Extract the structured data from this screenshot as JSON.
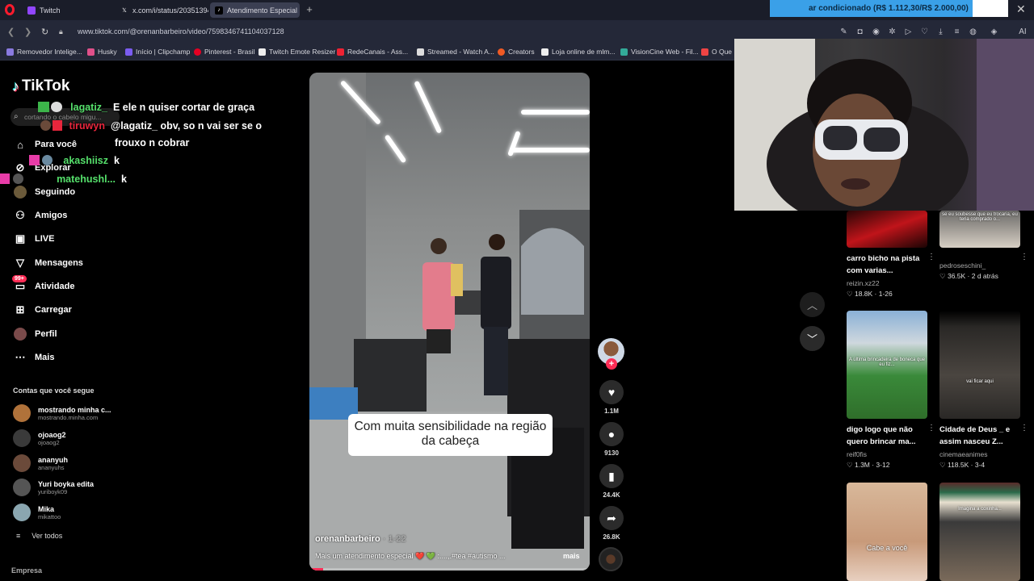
{
  "browser": {
    "tabs": [
      {
        "label": "Twitch",
        "icon": "twitch-icon"
      },
      {
        "label": "x.com/i/status/203513940",
        "icon": "x-icon"
      },
      {
        "label": "Atendimento Especial",
        "icon": "tiktok-icon"
      }
    ],
    "url": "www.tiktok.com/@orenanbarbeiro/video/7598346741104037128",
    "bookmarks": [
      "Removedor Intelige...",
      "Husky",
      "Início | Clipchamp",
      "Pinterest - Brasil",
      "Twitch Emote Resizer",
      "RedeCanais - Ass...",
      "Streamed - Watch A...",
      "Creators",
      "Loja online de mlm...",
      "VisionCine Web - Fil...",
      "O Que"
    ],
    "ai_label": "AI"
  },
  "overlay": {
    "donation_text": "ar condicionado (R$ 1.112,30/R$ 2.000,00)",
    "close": "✕"
  },
  "sidebar": {
    "logo": "TikTok",
    "search_placeholder": "cortando o cabelo migu...",
    "nav": [
      {
        "label": "Para você",
        "icon": "home-icon"
      },
      {
        "label": "Explorar",
        "icon": "compass-icon"
      },
      {
        "label": "Seguindo",
        "icon": "following-icon"
      },
      {
        "label": "Amigos",
        "icon": "friends-icon"
      },
      {
        "label": "LIVE",
        "icon": "live-icon"
      },
      {
        "label": "Mensagens",
        "icon": "messages-icon"
      },
      {
        "label": "Atividade",
        "icon": "activity-icon",
        "badge": "99+"
      },
      {
        "label": "Carregar",
        "icon": "upload-icon"
      },
      {
        "label": "Perfil",
        "icon": "profile-icon"
      },
      {
        "label": "Mais",
        "icon": "more-icon"
      }
    ],
    "following_title": "Contas que você segue",
    "accounts": [
      {
        "name": "mostrando minha c...",
        "handle": "mostrando.minha.com",
        "color": "#b0723a"
      },
      {
        "name": "ojoaog2",
        "handle": "ojoaog2",
        "color": "#3a3a3a"
      },
      {
        "name": "ananyuh",
        "handle": "ananyuhs",
        "color": "#6b4a3a"
      },
      {
        "name": "Yuri boyka edita",
        "handle": "yuriboyk09",
        "color": "#555"
      },
      {
        "name": "Mika",
        "handle": "mikattoo",
        "color": "#8aa6b0"
      }
    ],
    "see_all": "Ver todos",
    "company": "Empresa"
  },
  "chat": [
    {
      "user": "lagatiz_",
      "user_color": "#55e06b",
      "message": "E ele n quiser cortar de graça"
    },
    {
      "user": "tiruwyn",
      "user_color": "#e8263c",
      "message": "@lagatiz_ obv, so n vai ser se o"
    },
    {
      "user": "",
      "user_color": "#fff",
      "message": "frouxo n cobrar"
    },
    {
      "user": "akashiisz",
      "user_color": "#55e06b",
      "message": "k"
    },
    {
      "user": "matehushl...",
      "user_color": "#55e06b",
      "message": "k"
    }
  ],
  "video": {
    "caption": "Com muita sensibilidade na região da cabeça",
    "author": "orenanbarbeiro",
    "date": "· 1-22",
    "description": "Mais um atendimento especial ❤️ 💚 :....,.#tea #autismo ...",
    "more": "mais",
    "progress": 0.05
  },
  "actions": {
    "likes": "1.1M",
    "comments": "9130",
    "saves": "24.4K",
    "shares": "26.8K"
  },
  "recommendations": [
    {
      "title": "carro bicho na pista com varias...",
      "author": "reizin.xz22",
      "stats": "♡ 18.8K · 1-26",
      "colors": [
        "#1a0505",
        "#c0141a"
      ]
    },
    {
      "title": "",
      "author": "pedroseschini_",
      "stats": "♡ 36.5K · 2 d atrás",
      "colors": [
        "#6b6a68",
        "#d7cfc4"
      ],
      "overlay": "se eu soubesse que eu trocaria, eu teria comprado o..."
    },
    {
      "title": "digo logo que não quero brincar ma...",
      "author": "reif0fis",
      "stats": "♡ 1.3M · 3-12",
      "colors": [
        "#8ab0d6",
        "#3a8a3a"
      ],
      "overlay": "A última brincadeira de boneca que eu fiz..."
    },
    {
      "title": "Cidade de Deus _ e assim nasceu Z...",
      "author": "cinemaeanimes",
      "stats": "♡ 118.5K · 3-4",
      "colors": [
        "#222",
        "#4a4540"
      ],
      "overlay": "vai ficar aqui"
    },
    {
      "title": "",
      "author": "",
      "stats": "",
      "colors": [
        "#c89a7a",
        "#e8d0c0"
      ],
      "overlay": "Cabe a você"
    },
    {
      "title": "",
      "author": "",
      "stats": "",
      "colors": [
        "#3a3a3a",
        "#7a6a5a"
      ],
      "overlay": "Imagina a coxinha..."
    }
  ]
}
